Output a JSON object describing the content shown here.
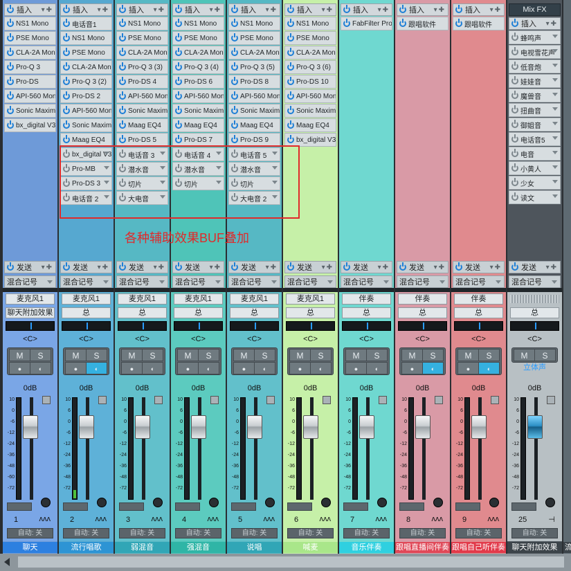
{
  "insert_label": "插入",
  "send_label": "发送",
  "auto_label": "自动: 关",
  "pan_label": "<C>",
  "db_label": "0dB",
  "mute_label": "M",
  "solo_label": "S",
  "annotation_text": "各种辅助效果BUF叠加",
  "scale_ticks": [
    "10",
    "6",
    "0",
    "-6",
    "-12",
    "-24",
    "-36",
    "-48",
    "-72"
  ],
  "scale_ticks_b": [
    "10",
    "0",
    "-6",
    "-12",
    "-24",
    "-36",
    "-48",
    "-60",
    "-72"
  ],
  "channels": [
    {
      "number": "1",
      "name": "聊天",
      "input": "麦克风1",
      "output": "聊天附加效果",
      "route": "混合记号",
      "color": "#6e9ad8",
      "bottom_color": "#2d80e0",
      "strip_color": "#7aa6e6",
      "inserts": [
        "NS1 Mono",
        "PSE Mono",
        "CLA-2A Mono",
        "Pro-Q 3",
        "Pro-DS",
        "API-560 Mono",
        "Sonic Maxim...",
        "bx_digital V3"
      ],
      "gray_inserts": [],
      "monitor_on": false,
      "level_pct": 0
    },
    {
      "number": "2",
      "name": "流行唱歌",
      "input": "麦克风1",
      "output": "总",
      "route": "混合记号",
      "color": "#56a8d0",
      "bottom_color": "#2d94d4",
      "strip_color": "#5eb1d8",
      "inserts": [
        "电话音1",
        "NS1 Mono",
        "PSE Mono",
        "CLA-2A Mono",
        "Pro-Q 3 (2)",
        "Pro-DS 2",
        "API-560 Mono",
        "Sonic Maxim...",
        "Maag EQ4"
      ],
      "gray_inserts": [
        "bx_digital V3",
        "Pro-MB",
        "Pro-DS 3",
        "电话音 2"
      ],
      "monitor_on": true,
      "level_pct": 8
    },
    {
      "number": "3",
      "name": "弱混音",
      "input": "麦克风1",
      "output": "总",
      "route": "混合记号",
      "color": "#56b8c4",
      "bottom_color": "#31a6b6",
      "strip_color": "#62c0cb",
      "inserts": [
        "NS1 Mono",
        "PSE Mono",
        "CLA-2A Mono",
        "Pro-Q 3 (3)",
        "Pro-DS 4",
        "API-560 Mono",
        "Sonic Maxim...",
        "Maag EQ4",
        "Pro-DS 5"
      ],
      "gray_inserts": [
        "电话音 3",
        "潜水音",
        "切片",
        "大电音"
      ],
      "monitor_on": false,
      "level_pct": 0
    },
    {
      "number": "4",
      "name": "强混音",
      "input": "麦克风1",
      "output": "总",
      "route": "混合记号",
      "color": "#4fc4b8",
      "bottom_color": "#2fb5a6",
      "strip_color": "#5ccbbf",
      "inserts": [
        "NS1 Mono",
        "PSE Mono",
        "CLA-2A Mono",
        "Pro-Q 3 (4)",
        "Pro-DS 6",
        "API-560 Mono",
        "Sonic Maxim...",
        "Maag EQ4",
        "Pro-DS 7"
      ],
      "gray_inserts": [
        "电话音 4",
        "潜水音",
        "切片"
      ],
      "monitor_on": false,
      "level_pct": 0
    },
    {
      "number": "5",
      "name": "说唱",
      "input": "麦克风1",
      "output": "总",
      "route": "混合记号",
      "color": "#56b8c4",
      "bottom_color": "#31a6b6",
      "strip_color": "#62c0cb",
      "inserts": [
        "NS1 Mono",
        "PSE Mono",
        "CLA-2A Mono",
        "Pro-Q 3 (5)",
        "Pro-DS 8",
        "API-560 Mono",
        "Sonic Maxim...",
        "Maag EQ4",
        "Pro-DS 9"
      ],
      "gray_inserts": [
        "电话音 5",
        "潜水音",
        "切片",
        "大电音 2"
      ],
      "monitor_on": false,
      "level_pct": 0
    },
    {
      "number": "6",
      "name": "喊麦",
      "input": "麦克风1",
      "output": "总",
      "route": "混合记号",
      "color": "#c6f0a8",
      "bottom_color": "#a9e68a",
      "strip_color": "#c6f0a8",
      "inserts": [
        "NS1 Mono",
        "PSE Mono",
        "CLA-2A Mono",
        "Pro-Q 3 (6)",
        "Pro-DS 10",
        "API-560 Mono",
        "Sonic Maxim...",
        "Maag EQ4",
        "bx_digital V3"
      ],
      "gray_inserts": [],
      "monitor_on": false,
      "level_pct": 0
    },
    {
      "number": "7",
      "name": "音乐伴奏",
      "input": "伴奏",
      "output": "总",
      "route": "混合记号",
      "color": "#6fd8d0",
      "bottom_color": "#2fd0e0",
      "strip_color": "#6fd8d0",
      "inserts": [
        "FabFilter Pro..."
      ],
      "gray_inserts": [],
      "monitor_on": false,
      "level_pct": 0
    },
    {
      "number": "8",
      "name": "跟唱直播间伴奏",
      "input": "伴奏",
      "output": "总",
      "route": "混合记号",
      "color": "#d99aa6",
      "bottom_color": "#e04858",
      "strip_color": "#d99aa6",
      "inserts": [
        "跟唱软件"
      ],
      "gray_inserts": [],
      "monitor_on": true,
      "level_pct": 0
    },
    {
      "number": "9",
      "name": "跟唱自己听伴奏",
      "input": "伴奏",
      "output": "总",
      "route": "混合记号",
      "color": "#e08a8e",
      "bottom_color": "#e23a4a",
      "strip_color": "#e08a8e",
      "inserts": [
        "跟唱软件"
      ],
      "gray_inserts": [],
      "monitor_on": true,
      "level_pct": 0
    }
  ],
  "fx_channel": {
    "title": "Mix FX",
    "number": "25",
    "name": "聊天附加效果",
    "output": "总",
    "stereo": "立体声",
    "route": "混合记号",
    "inserts": [
      "蜂鸣声",
      "电视雪花声",
      "低音炮",
      "娃娃音",
      "魔兽音",
      "扭曲音",
      "御姐音",
      "电话音5",
      "电音",
      "小黄人",
      "少女",
      "读文"
    ]
  },
  "partial_channel": {
    "name": "流"
  }
}
